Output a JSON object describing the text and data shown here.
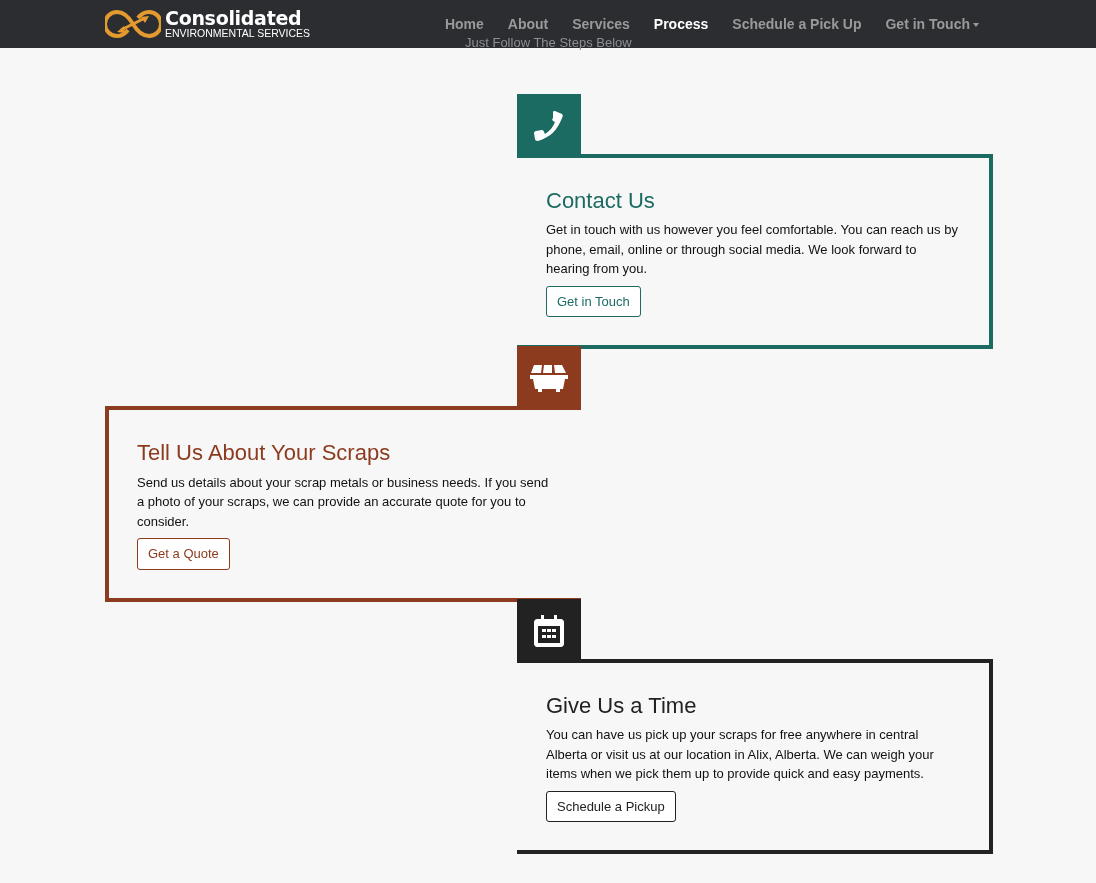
{
  "navbar": {
    "brand": {
      "name": "Consolidated",
      "tagline": "ENVIRONMENTAL SERVICES"
    },
    "items": [
      {
        "label": "Home",
        "selected": false,
        "dropdown": false
      },
      {
        "label": "About",
        "selected": false,
        "dropdown": false
      },
      {
        "label": "Services",
        "selected": false,
        "dropdown": false
      },
      {
        "label": "Process",
        "selected": true,
        "dropdown": false
      },
      {
        "label": "Schedule a Pick Up",
        "selected": false,
        "dropdown": false
      },
      {
        "label": "Get in Touch",
        "selected": false,
        "dropdown": true
      }
    ]
  },
  "heading": "Just Follow The Steps Below",
  "steps": [
    {
      "flipped": false,
      "kind": "phone",
      "color": "#1b6b63",
      "title": "Contact Us",
      "text": "Get in touch with us however you feel comfortable. You can reach us by phone, email, online or through social media. We look forward to hearing from you.",
      "button": "Get in Touch"
    },
    {
      "flipped": true,
      "kind": "dumpster",
      "color": "#8c3b1e",
      "title": "Tell Us About Your Scraps",
      "text": "Send us details about your scrap metals or business needs. If you send a photo of your scraps, we can provide an accurate quote for you to consider.",
      "button": "Get a Quote"
    },
    {
      "flipped": false,
      "kind": "calendar",
      "color": "#222222",
      "title": "Give Us a Time",
      "text": "You can have us pick up your scraps for free anywhere in central Alberta or visit us at our location in Alix, Alberta. We can weigh your items when we pick them up to provide quick and easy payments.",
      "button": "Schedule a Pickup"
    }
  ]
}
